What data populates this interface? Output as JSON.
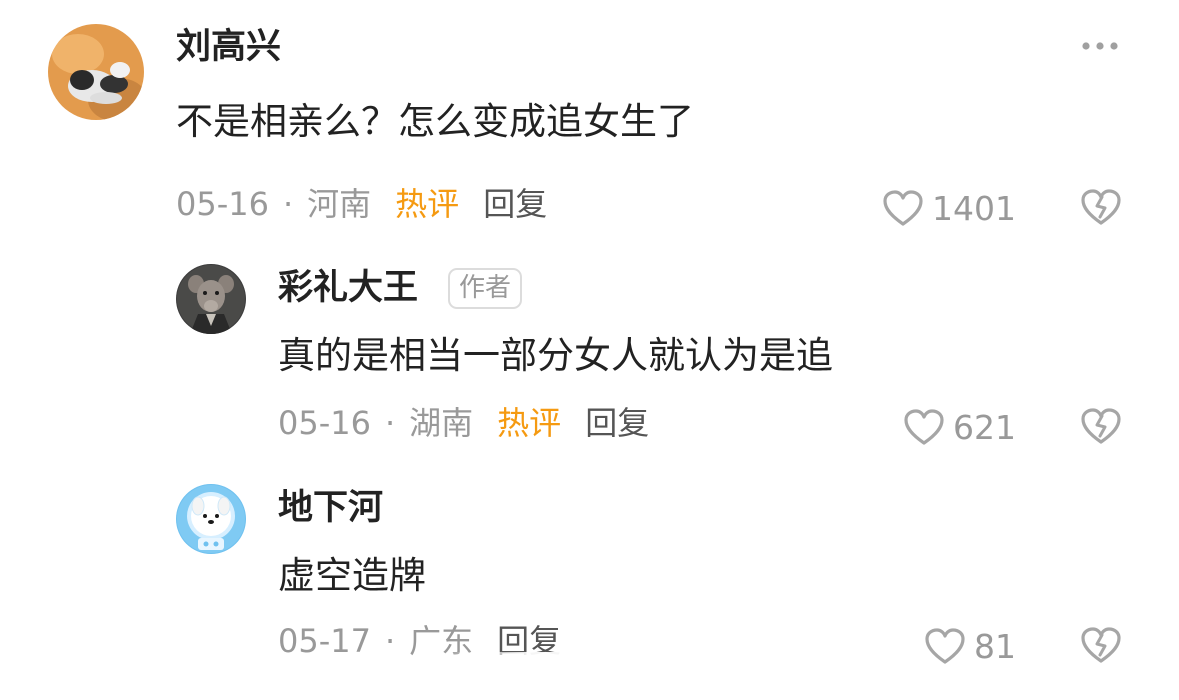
{
  "comments": [
    {
      "username": "刘高兴",
      "text": "不是相亲么？怎么变成追女生了",
      "date": "05-16",
      "location": "河南",
      "hot_label": "热评",
      "reply_label": "回复",
      "likes": "1401",
      "more_label": "•••"
    },
    {
      "username": "彩礼大王",
      "badge": "作者",
      "text": "真的是相当一部分女人就认为是追",
      "date": "05-16",
      "location": "湖南",
      "hot_label": "热评",
      "reply_label": "回复",
      "likes": "621"
    },
    {
      "username": "地下河",
      "text": "虚空造牌",
      "date": "05-17",
      "location": "广东",
      "reply_label": "回复",
      "likes": "81"
    }
  ],
  "separator": "·",
  "colors": {
    "hot": "#f59a11",
    "muted": "#999999",
    "text": "#222222"
  }
}
